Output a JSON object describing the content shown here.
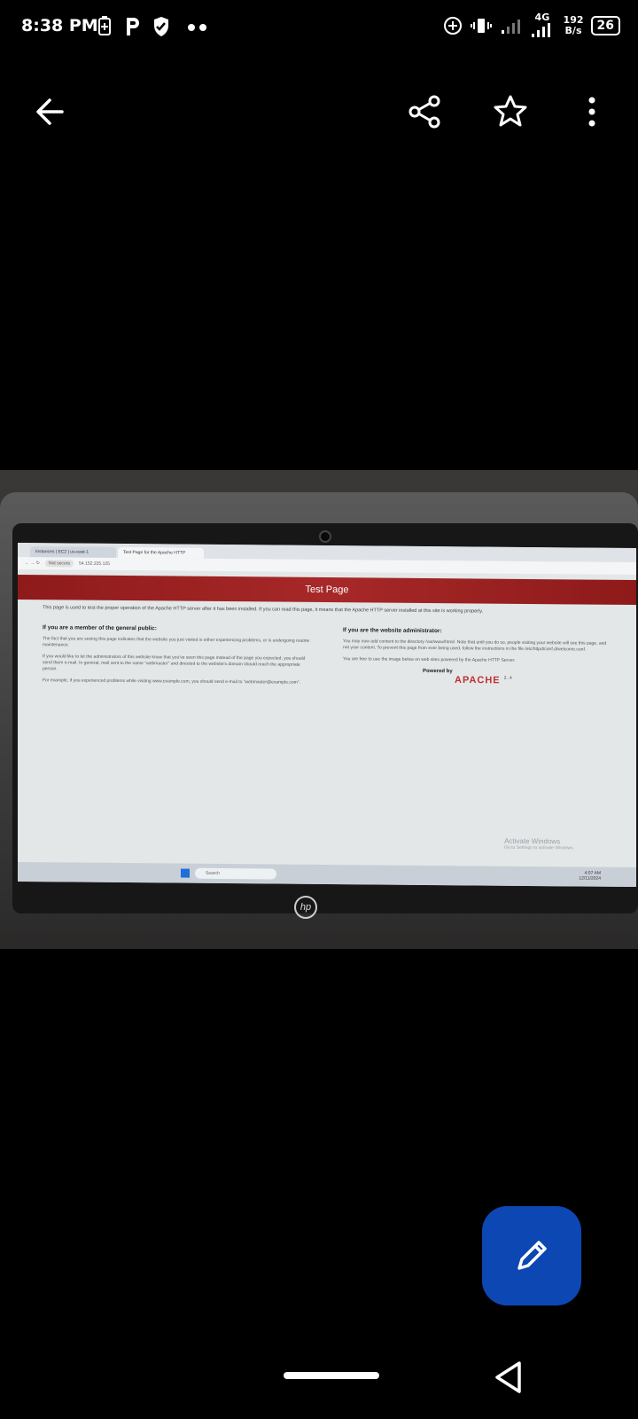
{
  "status_bar": {
    "time": "8:38 PM",
    "network": "4G",
    "speed_value": "192",
    "speed_unit": "B/s",
    "battery": "26"
  },
  "top_bar": {
    "back_icon": "arrow-left-icon",
    "share_icon": "share-icon",
    "favorite_icon": "star-outline-icon",
    "more_icon": "more-vertical-icon"
  },
  "photo": {
    "browser": {
      "tabs": [
        "Instances | EC2 | us-east-1",
        "Test Page for the Apache HTTP"
      ],
      "url_security": "Not secure",
      "url": "54.152.225.125"
    },
    "page": {
      "header": "Test Page",
      "intro": "This page is used to test the proper operation of the Apache HTTP server after it has been installed. If you can read this page, it means that the Apache HTTP server installed at this site is working properly.",
      "left_heading": "If you are a member of the general public:",
      "left_paragraphs": [
        "The fact that you are seeing this page indicates that the website you just visited is either experiencing problems, or is undergoing routine maintenance.",
        "If you would like to let the administrators of this website know that you've seen this page instead of the page you expected, you should send them e-mail. In general, mail sent to the name \"webmaster\" and directed to the website's domain should reach the appropriate person.",
        "For example, if you experienced problems while visiting www.example.com, you should send e-mail to \"webmaster@example.com\"."
      ],
      "right_heading": "If you are the website administrator:",
      "right_paragraphs": [
        "You may now add content to the directory /var/www/html/. Note that until you do so, people visiting your website will see this page, and not your content. To prevent this page from ever being used, follow the instructions in the file /etc/httpd/conf.d/welcome.conf.",
        "You are free to use the image below on web sites powered by the Apache HTTP Server:"
      ],
      "powered_by": "Powered by",
      "apache_logo": "APACHE",
      "apache_version": "2.4"
    },
    "windows": {
      "activate_title": "Activate Windows",
      "activate_sub": "Go to Settings to activate Windows.",
      "search_placeholder": "Search",
      "tray_time": "4:07 AM",
      "tray_date": "12/11/2024"
    },
    "laptop_brand": "hp"
  },
  "fab": {
    "icon": "pencil-edit-icon"
  },
  "nav": {
    "home_pill": "home-pill",
    "back_icon": "nav-back-triangle-icon"
  }
}
